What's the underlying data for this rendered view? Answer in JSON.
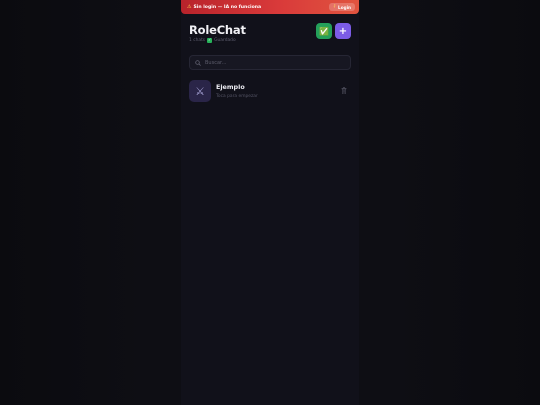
{
  "banner": {
    "warning_icon": "warning-icon",
    "text": "Sin login — IA no funciona",
    "login_label": "Login",
    "login_icon": "key-icon"
  },
  "header": {
    "title": "RoleChat",
    "count": "1 chats",
    "status": "Guardado",
    "status_icon": "check-icon"
  },
  "actions": {
    "check_icon": "✅",
    "add_icon": "+"
  },
  "search": {
    "placeholder": "Buscar...",
    "icon": "search-icon"
  },
  "chats": [
    {
      "name": "Ejemplo",
      "preview": "Toca para empezar",
      "avatar_icon": "crossed-swords-icon",
      "delete_icon": "trash-icon"
    }
  ],
  "colors": {
    "background": "#0b0b10",
    "panel": "#11111a",
    "banner_red": "#d93a3a",
    "green_button": "#24a05a",
    "purple_button": "#7c5ce6",
    "avatar_bg": "#2a2548"
  }
}
